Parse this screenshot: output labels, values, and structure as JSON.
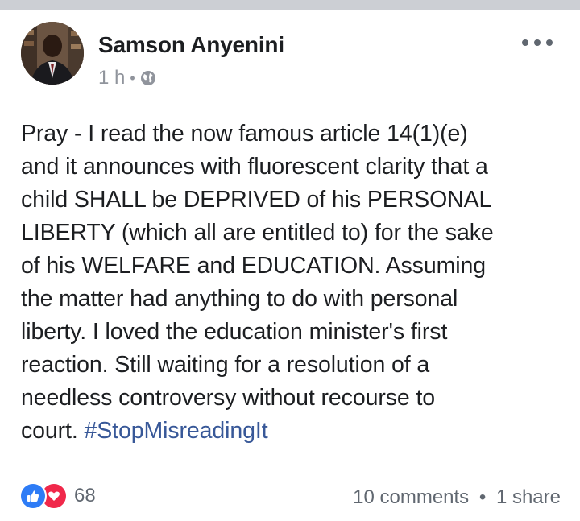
{
  "post": {
    "author": "Samson Anyenini",
    "time": "1 h",
    "audience_icon": "globe-icon",
    "body_lines": [
      "Pray - I read the now famous article 14(1)(e)",
      "and it announces with fluorescent clarity that a",
      "child SHALL be DEPRIVED of his PERSONAL",
      "LIBERTY (which all are entitled to) for the sake",
      "of his WELFARE and EDUCATION. Assuming",
      "the matter had anything to do with personal",
      "liberty. I loved the education minister's first",
      "reaction. Still waiting for a resolution of a",
      "needless controversy without recourse to",
      "court. "
    ],
    "hashtag": "#StopMisreadingIt",
    "reactions": {
      "icons": [
        "like-icon",
        "love-icon"
      ],
      "count": "68"
    },
    "comments": "10 comments",
    "shares": "1 share"
  },
  "colors": {
    "hashtag": "#385898",
    "meta_text": "#90949c",
    "like": "#2e7cf6",
    "love": "#f0284a"
  }
}
